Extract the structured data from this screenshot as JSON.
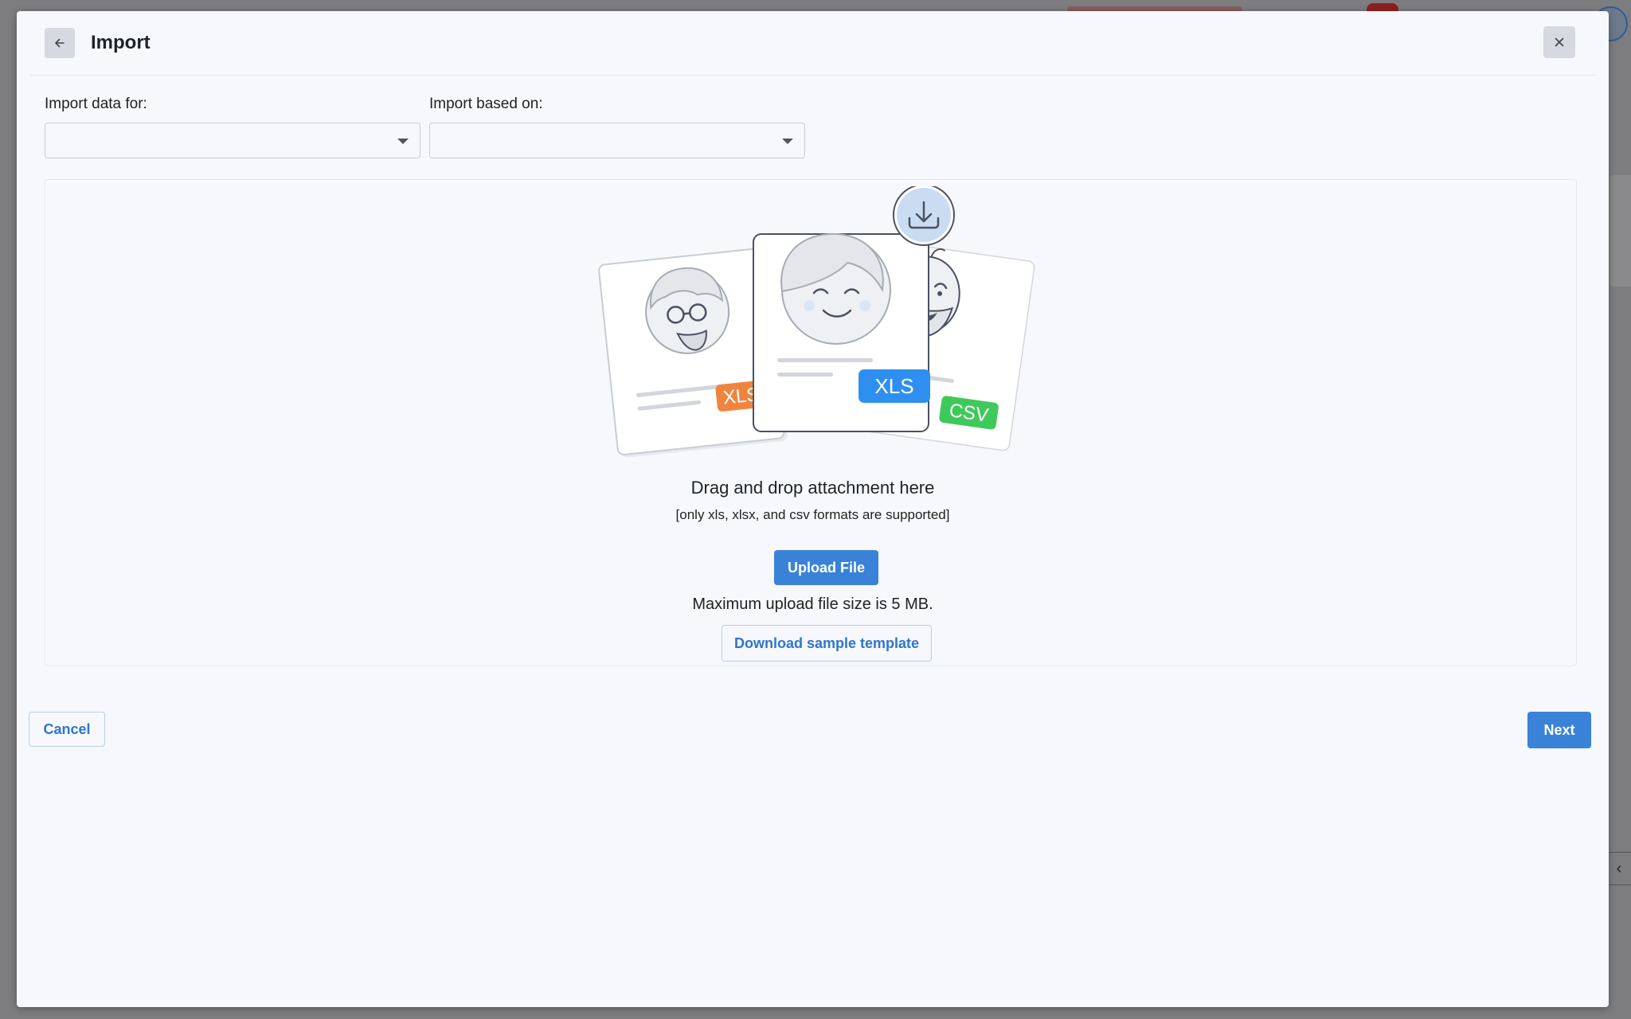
{
  "header": {
    "title": "Import",
    "back_icon": "arrow-left-icon",
    "close_icon": "close-icon"
  },
  "form": {
    "import_data_for": {
      "label": "Import data for:",
      "value": ""
    },
    "import_based_on": {
      "label": "Import based on:",
      "value": ""
    }
  },
  "dropzone": {
    "title": "Drag and drop attachment here",
    "subtitle": "[only xls, xlsx, and csv formats are supported]",
    "upload_label": "Upload File",
    "max_size_text": "Maximum upload file size is 5 MB.",
    "template_label": "Download sample template",
    "illustration": {
      "badges": [
        "XLSX",
        "XLS",
        "CSV"
      ],
      "badge_colors": {
        "xlsx": "#f0843f",
        "xls": "#2f8ff0",
        "csv": "#3fc95a"
      }
    }
  },
  "footer": {
    "cancel_label": "Cancel",
    "next_label": "Next"
  },
  "colors": {
    "primary": "#3a82d8",
    "modal_bg": "#f6f8fc",
    "overlay": "#7d7d7f"
  }
}
